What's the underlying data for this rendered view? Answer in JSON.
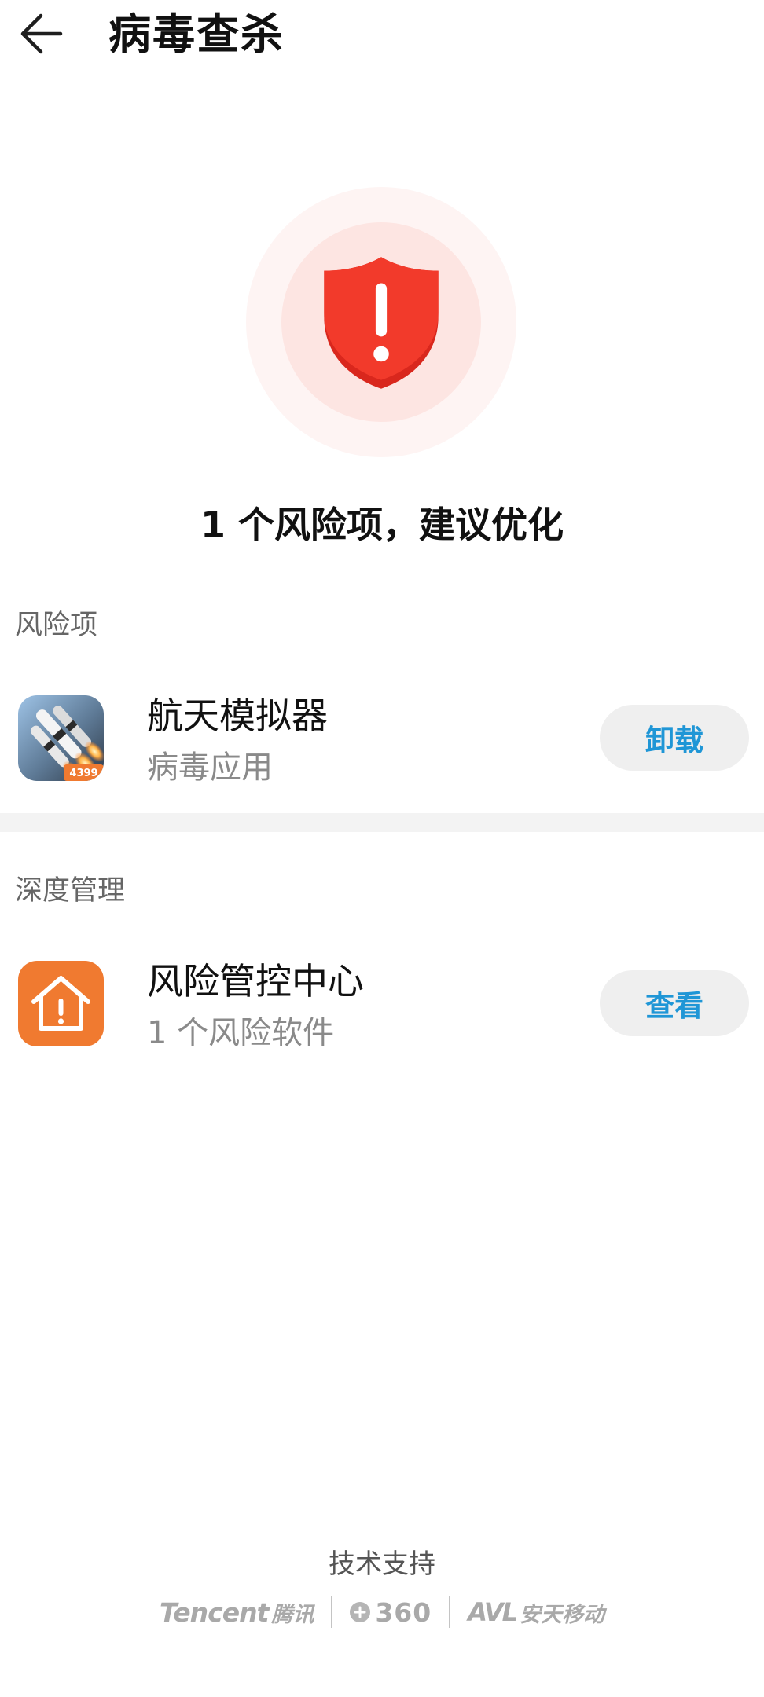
{
  "header": {
    "title": "病毒查杀",
    "back_icon": "back-arrow-icon"
  },
  "status": {
    "icon": "shield-alert-icon",
    "headline": "1 个风险项，建议优化"
  },
  "sections": [
    {
      "label": "风险项",
      "items": [
        {
          "icon": "rocket-app-icon",
          "icon_badge": "4399",
          "title": "航天模拟器",
          "subtitle": "病毒应用",
          "action": "卸载"
        }
      ]
    },
    {
      "label": "深度管理",
      "items": [
        {
          "icon": "house-alert-icon",
          "title": "风险管控中心",
          "subtitle": "1 个风险软件",
          "action": "查看"
        }
      ]
    }
  ],
  "footer": {
    "label": "技术支持",
    "partners": [
      {
        "name": "Tencent",
        "suffix": "腾讯"
      },
      {
        "name": "360",
        "icon": "360-logo-icon"
      },
      {
        "name": "AVL",
        "suffix": "安天移动"
      }
    ]
  },
  "colors": {
    "accent": "#1f96d6",
    "danger": "#f03b2c",
    "danger_dark": "#d9271d",
    "orange": "#f07a30"
  }
}
